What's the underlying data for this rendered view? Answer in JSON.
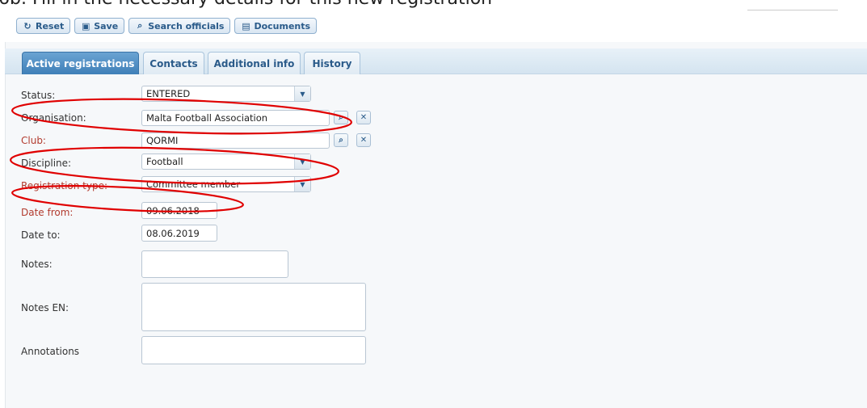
{
  "instruction": "6b. Fill in the necessary details for this new registration",
  "toolbar": {
    "reset": "Reset",
    "save": "Save",
    "search_officials": "Search officials",
    "documents": "Documents"
  },
  "tabs": [
    "Active registrations",
    "Contacts",
    "Additional info",
    "History"
  ],
  "form": {
    "status_label": "Status:",
    "status_value": "ENTERED",
    "organisation_label": "Organisation:",
    "organisation_value": "Malta Football Association",
    "club_label": "Club:",
    "club_value": "QORMI",
    "discipline_label": "Discipline:",
    "discipline_value": "Football",
    "registration_type_label": "Registration type:",
    "registration_type_value": "Committee member",
    "date_from_label": "Date from:",
    "date_from_value": "09.06.2018",
    "date_to_label": "Date to:",
    "date_to_value": "08.06.2019",
    "notes_label": "Notes:",
    "notes_en_label": "Notes EN:",
    "annotations_label": "Annotations"
  },
  "colors": {
    "accent": "#3f7fb8",
    "annotation_ellipse": "#e00000",
    "required_label": "#b23b2e"
  }
}
